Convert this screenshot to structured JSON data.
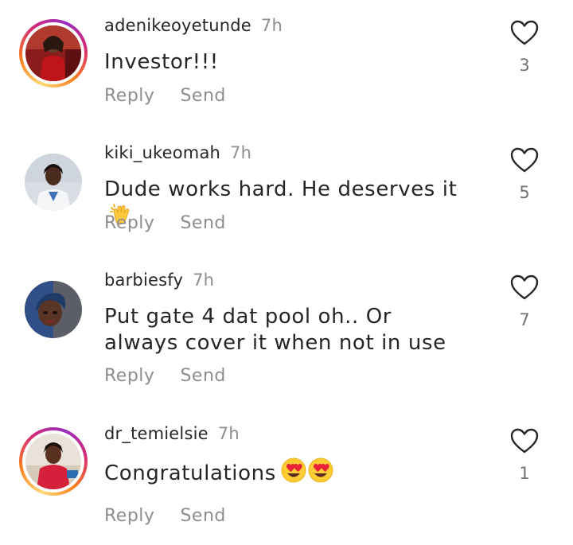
{
  "comments": [
    {
      "username": "adenikeoyetunde",
      "time": "7h",
      "text": "Investor!!!",
      "emoji": "",
      "reply_label": "Reply",
      "send_label": "Send",
      "likes": "3",
      "has_story": true
    },
    {
      "username": "kiki_ukeomah",
      "time": "7h",
      "text": "Dude works hard. He deserves it",
      "emoji": "clapping-hands",
      "reply_label": "Reply",
      "send_label": "Send",
      "likes": "5",
      "has_story": false
    },
    {
      "username": "barbiesfy",
      "time": "7h",
      "text": "Put gate 4 dat pool oh.. Or always cover it when not in use",
      "emoji": "",
      "reply_label": "Reply",
      "send_label": "Send",
      "likes": "7",
      "has_story": false
    },
    {
      "username": "dr_temielsie",
      "time": "7h",
      "text": "Congratulations",
      "emoji": "heart-eyes x2",
      "reply_label": "Reply",
      "send_label": "Send",
      "likes": "1",
      "has_story": true
    }
  ],
  "colors": {
    "text": "#262626",
    "muted": "#8e8e8e",
    "story_ring": [
      "#feda75",
      "#fa7e1e",
      "#d62976",
      "#962fbf"
    ]
  },
  "icons": {
    "like": "heart-outline-icon"
  }
}
